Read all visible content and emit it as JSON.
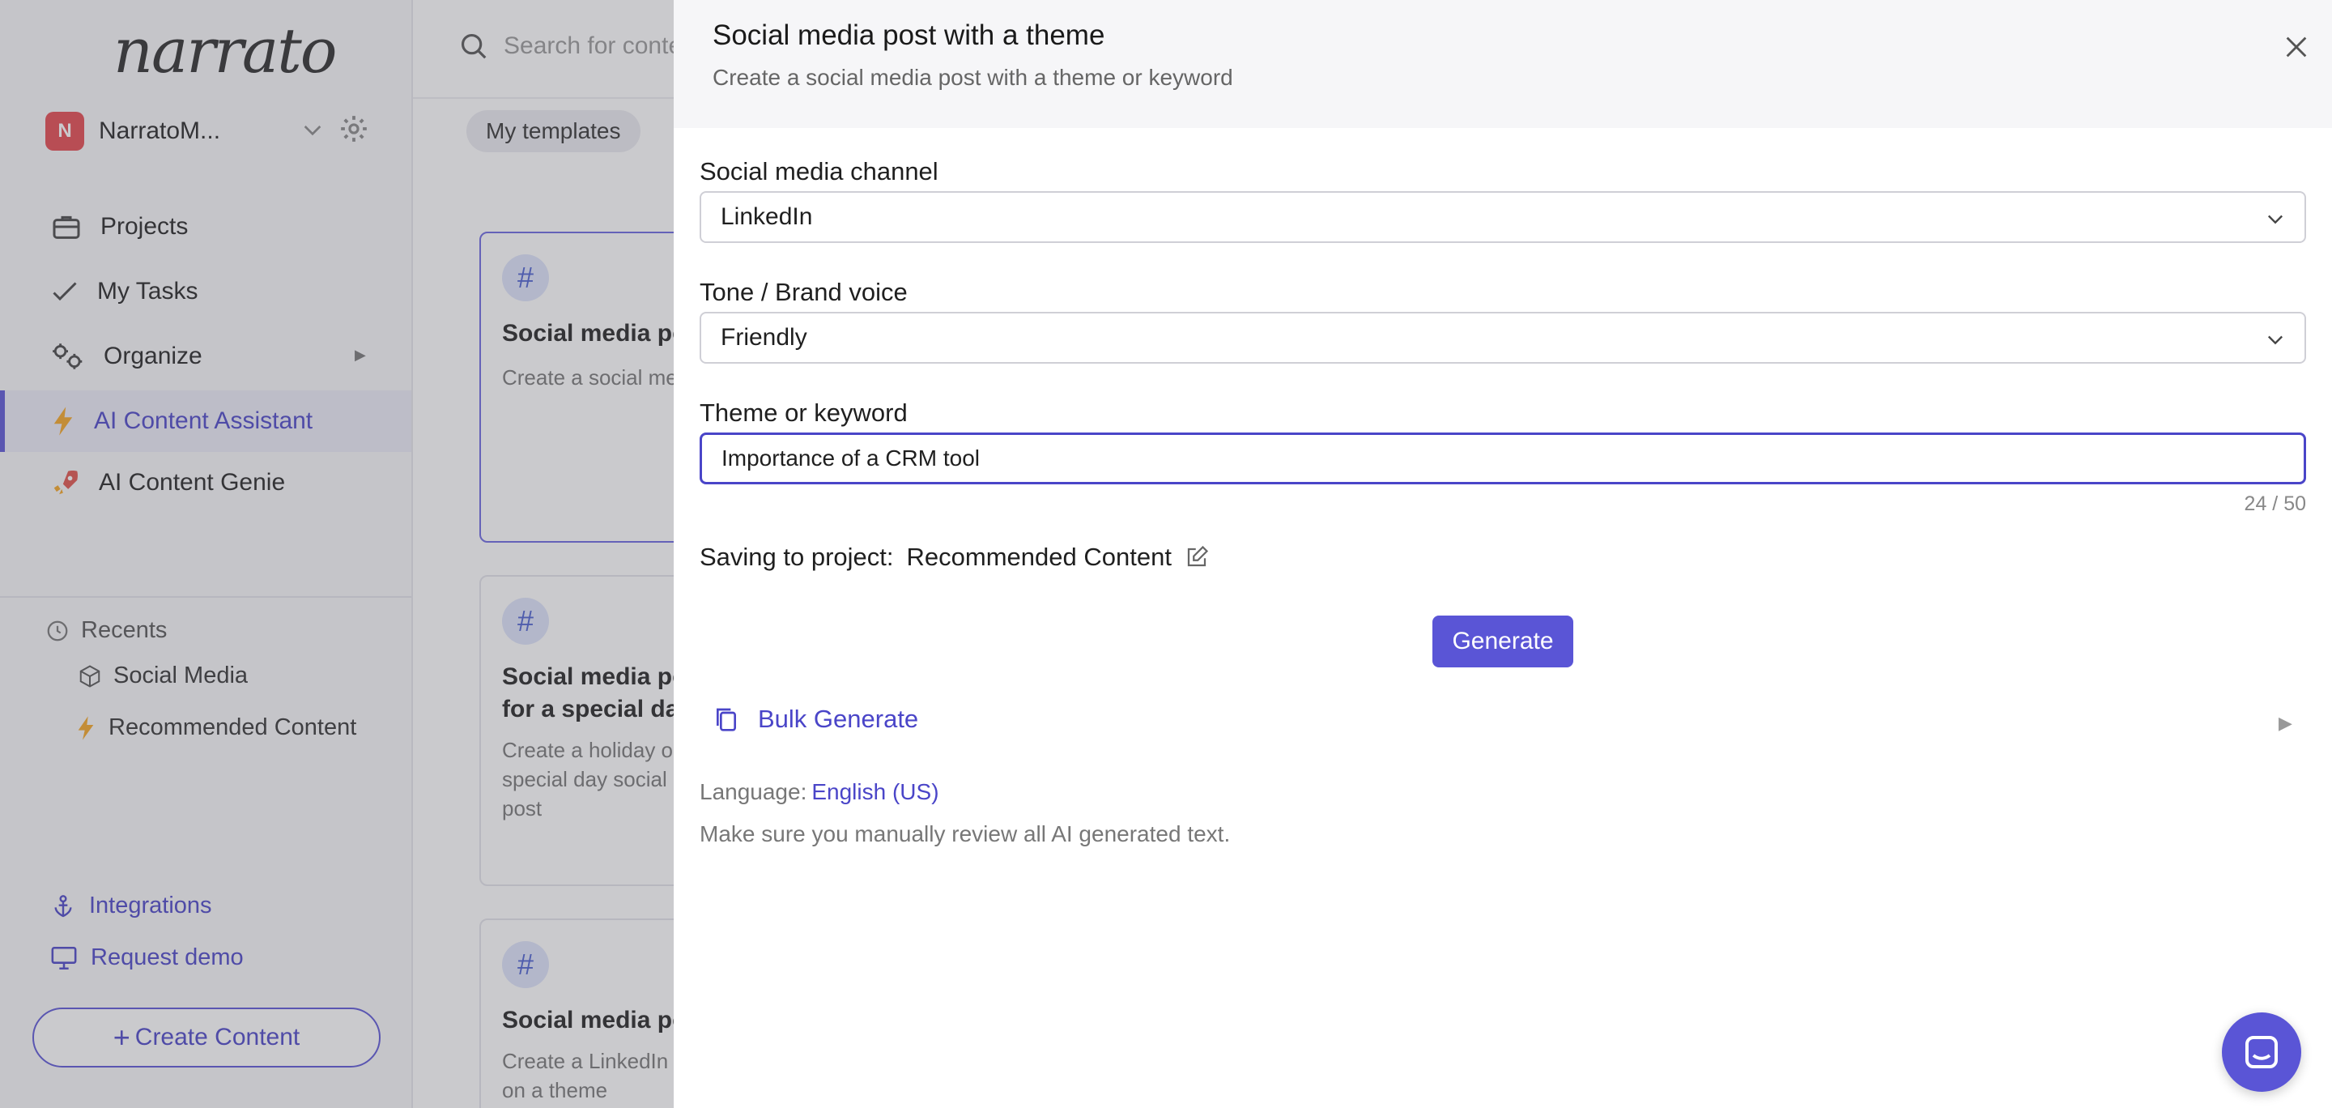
{
  "app": {
    "logo": "narrato",
    "workspace": {
      "initial": "N",
      "name": "NarratoM..."
    },
    "nav": {
      "projects": "Projects",
      "my_tasks": "My Tasks",
      "organize": "Organize",
      "ai_content_assistant": "AI Content Assistant",
      "ai_content_genie": "AI Content Genie"
    },
    "recents": {
      "label": "Recents",
      "items": [
        "Social Media",
        "Recommended Content"
      ]
    },
    "links": {
      "integrations": "Integrations",
      "request_demo": "Request demo"
    },
    "create_content": "Create Content",
    "search": {
      "placeholder": "Search for content"
    },
    "chip": "My templates",
    "cards": [
      {
        "title": "Social media post with a theme",
        "desc": "Create a social media post with a theme or keyword"
      },
      {
        "title": "Social media post for a special day",
        "desc": "Create a holiday or special day social media post"
      },
      {
        "title": "Social media post",
        "desc": "Create a LinkedIn post on a theme"
      }
    ],
    "accent_color": "#5a55d6"
  },
  "drawer": {
    "title": "Social media post with a theme",
    "subtitle": "Create a social media post with a theme or keyword",
    "channel": {
      "label": "Social media channel",
      "value": "LinkedIn"
    },
    "tone": {
      "label": "Tone / Brand voice",
      "value": "Friendly"
    },
    "theme": {
      "label": "Theme or keyword",
      "value": "Importance of a CRM tool",
      "counter": "24 / 50"
    },
    "saving": {
      "label": "Saving to project:",
      "project": "Recommended Content"
    },
    "generate_label": "Generate",
    "bulk_label": "Bulk Generate",
    "language": {
      "label": "Language:",
      "value": "English (US)"
    },
    "disclaimer": "Make sure you manually review all AI generated text."
  }
}
